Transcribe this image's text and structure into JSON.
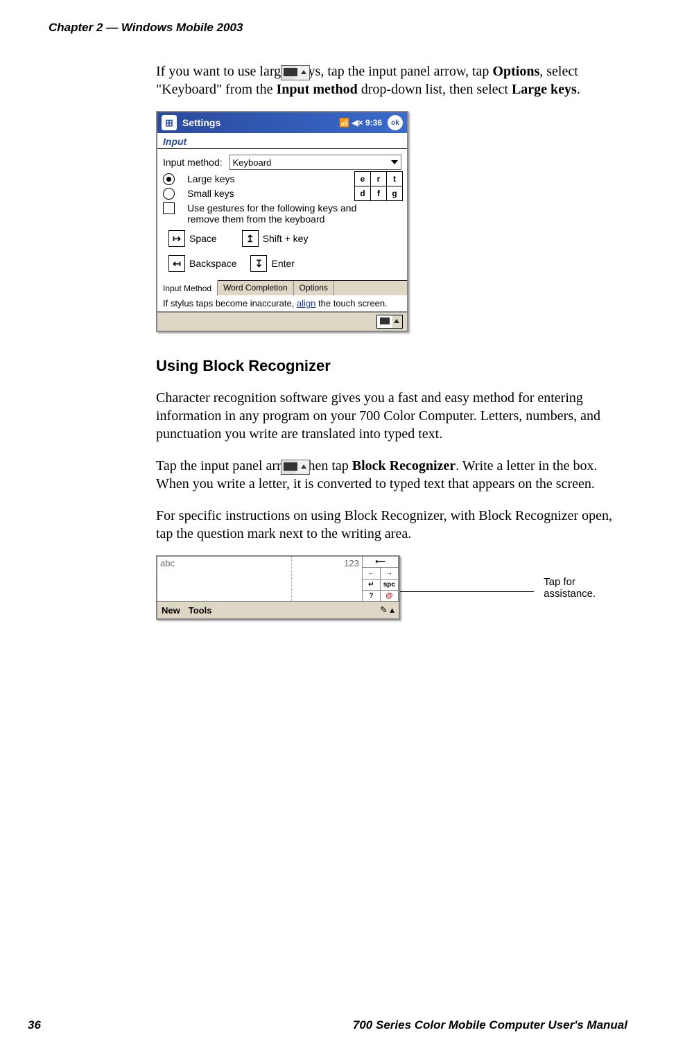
{
  "header": {
    "chapter": "Chapter 2",
    "dash": "  —  ",
    "title": "Windows Mobile 2003"
  },
  "footer": {
    "page": "36",
    "manual": "700 Series Color Mobile Computer User's Manual"
  },
  "para1": {
    "pre": "If you want to use larger keys, tap the input panel arrow, tap ",
    "opt": "Options",
    "mid1": ", select \"Keyboard\" from the ",
    "im": "Input method",
    "mid2": " drop-down list, then select ",
    "lk": "Large keys",
    "end": "."
  },
  "ss1": {
    "title": "Settings",
    "time": "9:36",
    "ok": "ok",
    "screen": "Input",
    "input_method_label": "Input method:",
    "input_method_value": "Keyboard",
    "large_keys": "Large keys",
    "small_keys": "Small keys",
    "keys_row1": [
      "e",
      "r",
      "t"
    ],
    "keys_row2": [
      "d",
      "f",
      "g"
    ],
    "gesture_text_l1": "Use gestures for the following keys and",
    "gesture_text_l2": "remove them from the keyboard",
    "g_space": "Space",
    "g_shift": "Shift + key",
    "g_back": "Backspace",
    "g_enter": "Enter",
    "tabs": [
      "Input Method",
      "Word Completion",
      "Options"
    ],
    "tip_pre": "If stylus taps become inaccurate, ",
    "tip_link": "align",
    "tip_post": " the touch screen."
  },
  "heading2": "Using Block Recognizer",
  "para2": "Character recognition software gives you a fast and easy method for entering information in any program on your 700 Color Computer. Letters, numbers, and punctuation you write are translated into typed text.",
  "para3": {
    "pre": "Tap the input panel arrow, then tap ",
    "br": "Block Recognizer",
    "post": ". Write a letter in the box. When you write a letter, it is converted to typed text that appears on the screen."
  },
  "para4": "For specific instructions on using Block Recognizer, with Block Recognizer open, tap the question mark next to the writing area.",
  "ss2": {
    "abc": "abc",
    "n123": "123",
    "new": "New",
    "tools": "Tools",
    "spc": "spc",
    "q": "?",
    "at": "@"
  },
  "callout": "Tap for assistance."
}
